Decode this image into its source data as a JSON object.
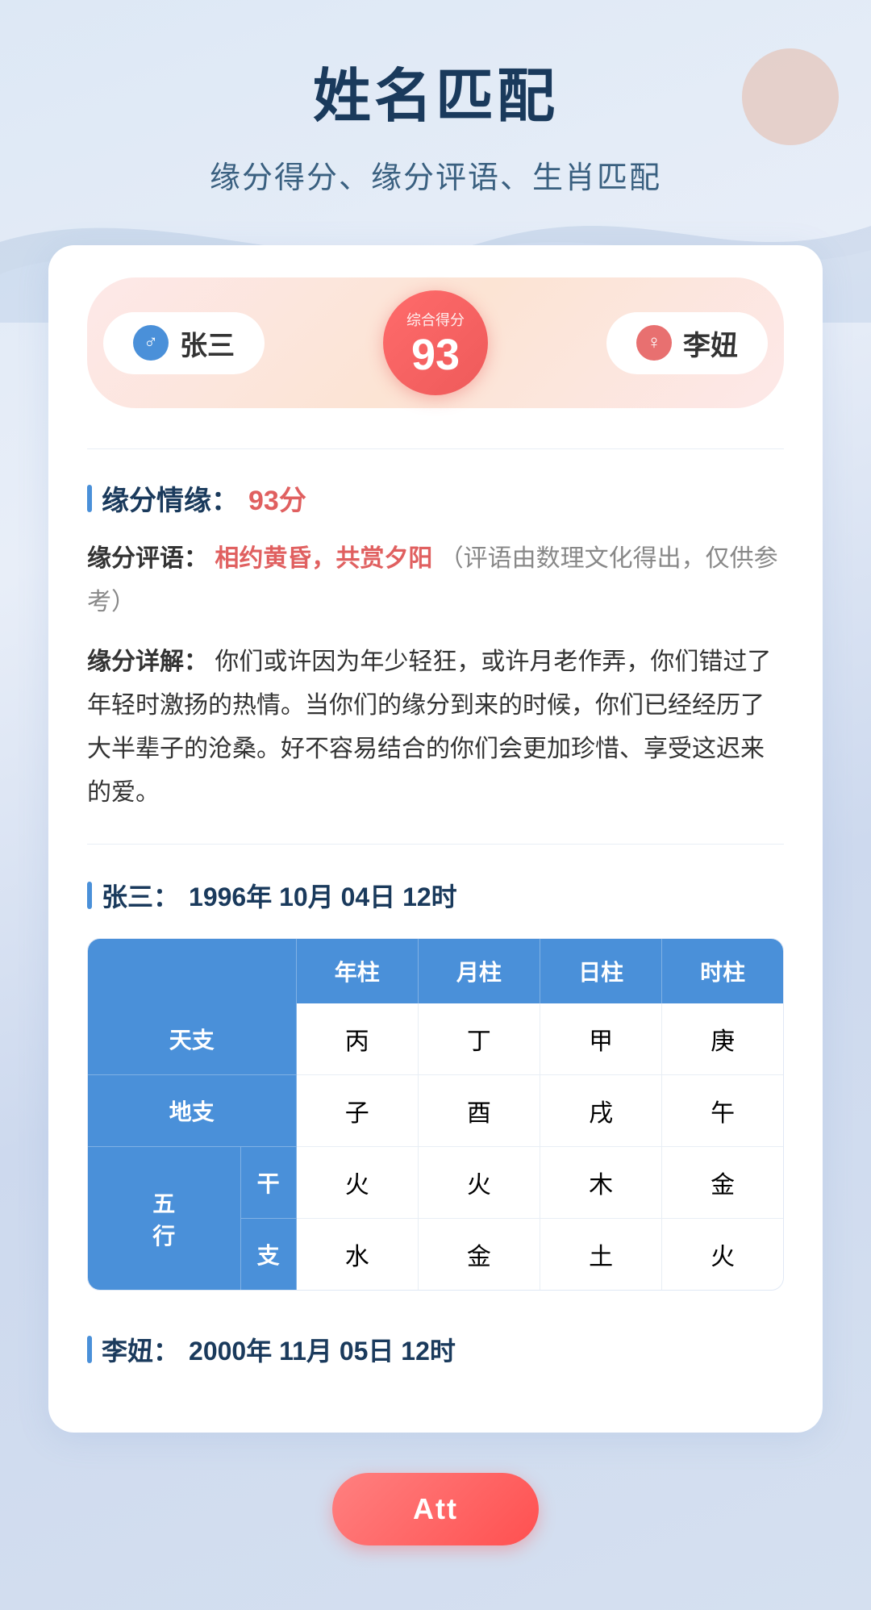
{
  "page": {
    "title": "姓名匹配",
    "subtitle": "缘分得分、缘分评语、生肖匹配"
  },
  "score_header": {
    "person1_name": "张三",
    "person1_icon": "♂",
    "person2_name": "李妞",
    "person2_icon": "♀",
    "score_label": "综合得分",
    "score_value": "93"
  },
  "fate_section": {
    "title": "缘分情缘：",
    "score": "93分",
    "comment_label": "缘分评语：",
    "comment_red": "相约黄昏，共赏夕阳",
    "comment_gray": "（评语由数理文化得出，仅供参考）",
    "detail_label": "缘分详解：",
    "detail_text": "你们或许因为年少轻狂，或许月老作弄，你们错过了年轻时激扬的热情。当你们的缘分到来的时候，你们已经经历了大半辈子的沧桑。好不容易结合的你们会更加珍惜、享受这迟来的爱。"
  },
  "person1_bazi": {
    "title": "张三：",
    "date": "1996年 10月 04日 12时",
    "headers": [
      "年柱",
      "月柱",
      "日柱",
      "时柱"
    ],
    "tiangan": [
      "丙",
      "丁",
      "甲",
      "庚"
    ],
    "dizhi": [
      "子",
      "酉",
      "戌",
      "午"
    ],
    "wuxing_gan": [
      "火",
      "火",
      "木",
      "金"
    ],
    "wuxing_zhi": [
      "水",
      "金",
      "土",
      "火"
    ]
  },
  "person2_bazi": {
    "title": "李妞：",
    "date": "2000年 11月 05日 12时"
  },
  "button": {
    "label": "Att"
  }
}
